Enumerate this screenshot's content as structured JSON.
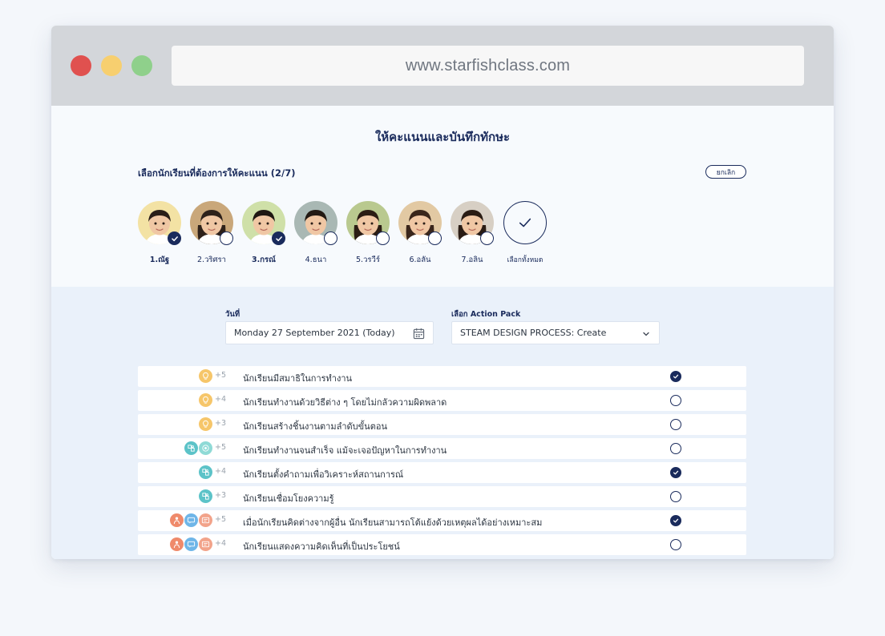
{
  "browser": {
    "url": "www.starfishclass.com"
  },
  "page": {
    "title": "ให้คะแนนและบันทึกทักษะ",
    "select_label": "เลือกนักเรียนที่ต้องการให้คะแนน (2/7)",
    "cancel_label": "ยกเลิก",
    "select_all_label": "เลือกทั้งหมด"
  },
  "students": [
    {
      "name": "1.ณัฐ",
      "selected": true
    },
    {
      "name": "2.วริศรา",
      "selected": false
    },
    {
      "name": "3.กรณ์",
      "selected": true
    },
    {
      "name": "4.ธนา",
      "selected": false
    },
    {
      "name": "5.วรวีร์",
      "selected": false
    },
    {
      "name": "6.อลัน",
      "selected": false
    },
    {
      "name": "7.อลิน",
      "selected": false
    }
  ],
  "form": {
    "date_label": "วันที่",
    "date_value": "Monday 27 September 2021 (Today)",
    "pack_label": "เลือก Action Pack",
    "pack_value": "STEAM DESIGN PROCESS: Create"
  },
  "skills": [
    {
      "points": "+5",
      "text": "นักเรียนมีสมาธิในการทำงาน",
      "checked": true,
      "icons": [
        "lightbulb-icon"
      ]
    },
    {
      "points": "+4",
      "text": "นักเรียนทำงานด้วยวิธีต่าง ๆ โดยไม่กลัวความผิดพลาด",
      "checked": false,
      "icons": [
        "lightbulb-icon"
      ]
    },
    {
      "points": "+3",
      "text": "นักเรียนสร้างชิ้นงานตามลำดับขั้นตอน",
      "checked": false,
      "icons": [
        "lightbulb-icon"
      ]
    },
    {
      "points": "+5",
      "text": "นักเรียนทำงานจนสำเร็จ แม้จะเจอปัญหาในการทำงาน",
      "checked": false,
      "icons": [
        "puzzle-icon",
        "target-icon"
      ]
    },
    {
      "points": "+4",
      "text": "นักเรียนตั้งคำถามเพื่อวิเคราะห์สถานการณ์",
      "checked": true,
      "icons": [
        "puzzle-icon"
      ]
    },
    {
      "points": "+3",
      "text": "นักเรียนเชื่อมโยงความรู้",
      "checked": false,
      "icons": [
        "puzzle-icon"
      ]
    },
    {
      "points": "+5",
      "text": "เมื่อนักเรียนคิดต่างจากผู้อื่น นักเรียนสามารถโต้แย้งด้วยเหตุผลได้อย่างเหมาะสม",
      "checked": true,
      "icons": [
        "person-icon",
        "chat-icon",
        "message-icon"
      ]
    },
    {
      "points": "+4",
      "text": "นักเรียนแสดงความคิดเห็นที่เป็นประโยชน์",
      "checked": false,
      "icons": [
        "person-icon",
        "chat-icon",
        "message-icon"
      ]
    }
  ],
  "colors": {
    "navy": "#1a2b5c",
    "row_bg": "#ffffff",
    "panel_bg": "#eaf1fa"
  }
}
